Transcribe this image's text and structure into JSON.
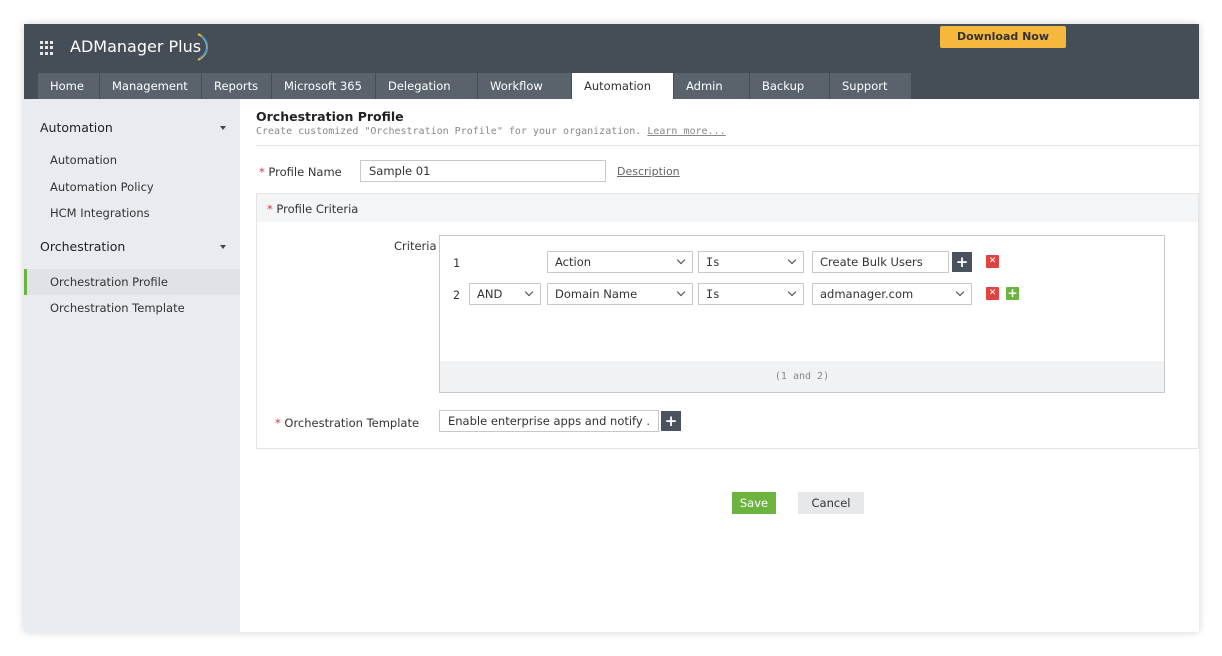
{
  "app": {
    "brand": "ADManager Plus",
    "download_label": "Download Now"
  },
  "tabs": [
    {
      "label": "Home"
    },
    {
      "label": "Management"
    },
    {
      "label": "Reports"
    },
    {
      "label": "Microsoft 365"
    },
    {
      "label": "Delegation"
    },
    {
      "label": "Workflow"
    },
    {
      "label": "Automation"
    },
    {
      "label": "Admin"
    },
    {
      "label": "Backup"
    },
    {
      "label": "Support"
    }
  ],
  "sidebar": {
    "automation_header": "Automation",
    "automation_items": [
      "Automation",
      "Automation Policy",
      "HCM Integrations"
    ],
    "orchestration_header": "Orchestration",
    "orchestration_items": [
      "Orchestration Profile",
      "Orchestration Template"
    ]
  },
  "page": {
    "title": "Orchestration Profile",
    "subtitle": "Create customized \"Orchestration Profile\" for your organization.",
    "learn_more": "Learn more...",
    "profile_name_label": "Profile Name",
    "profile_name_value": "Sample 01",
    "description_link": "Description",
    "profile_criteria_label": "Profile Criteria",
    "criteria_label": "Criteria",
    "criteria_rows": [
      {
        "num": "1",
        "field": "Action",
        "operator": "Is",
        "value": "Create Bulk Users"
      },
      {
        "num": "2",
        "conj": "AND",
        "field": "Domain Name",
        "operator": "Is",
        "value": "admanager.com"
      }
    ],
    "criteria_expression": "(1 and 2)",
    "template_label": "Orchestration Template",
    "template_value": "Enable enterprise apps and notify .",
    "save_label": "Save",
    "cancel_label": "Cancel"
  },
  "colors": {
    "topbar": "#454d57",
    "accent_green": "#6cb33f",
    "download_orange": "#f5b83c",
    "delete_red": "#e04242"
  }
}
